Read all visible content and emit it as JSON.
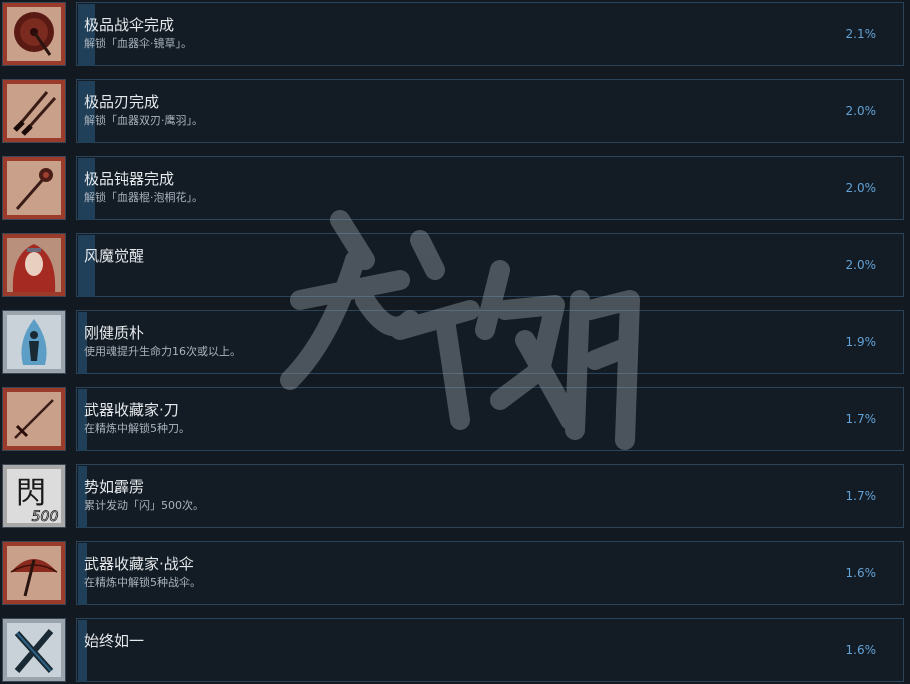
{
  "achievements": [
    {
      "title": "极品战伞完成",
      "desc": "解锁「血器伞·镜草」。",
      "pct": "2.1%",
      "icon": "crimson-umbrella-icon"
    },
    {
      "title": "极品刃完成",
      "desc": "解锁「血器双刃·鹰羽」。",
      "pct": "2.0%",
      "icon": "twin-blades-icon"
    },
    {
      "title": "极品钝器完成",
      "desc": "解锁「血器棍·泡桐花」。",
      "pct": "2.0%",
      "icon": "mace-icon"
    },
    {
      "title": "风魔觉醒",
      "desc": "",
      "pct": "2.0%",
      "icon": "red-haired-figure-icon"
    },
    {
      "title": "刚健质朴",
      "desc": "使用魂提升生命力16次或以上。",
      "pct": "1.9%",
      "icon": "blue-flame-figure-icon"
    },
    {
      "title": "武器收藏家·刀",
      "desc": "在精炼中解锁5种刀。",
      "pct": "1.7%",
      "icon": "katana-icon"
    },
    {
      "title": "势如霹雳",
      "desc": "累计发动「闪」500次。",
      "pct": "1.7%",
      "icon": "flash-kanji-icon",
      "icon_text": "閃",
      "icon_sub": "500"
    },
    {
      "title": "武器收藏家·战伞",
      "desc": "在精炼中解锁5种战伞。",
      "pct": "1.6%",
      "icon": "umbrella-collection-icon"
    },
    {
      "title": "始终如一",
      "desc": "",
      "pct": "1.6%",
      "icon": "crossed-blades-icon"
    }
  ],
  "colors": {
    "background": "#121920",
    "panel_border": "#2c4459",
    "progress_fill": "#203f58",
    "percent": "#63a2d6"
  },
  "watermark": "游侠网"
}
